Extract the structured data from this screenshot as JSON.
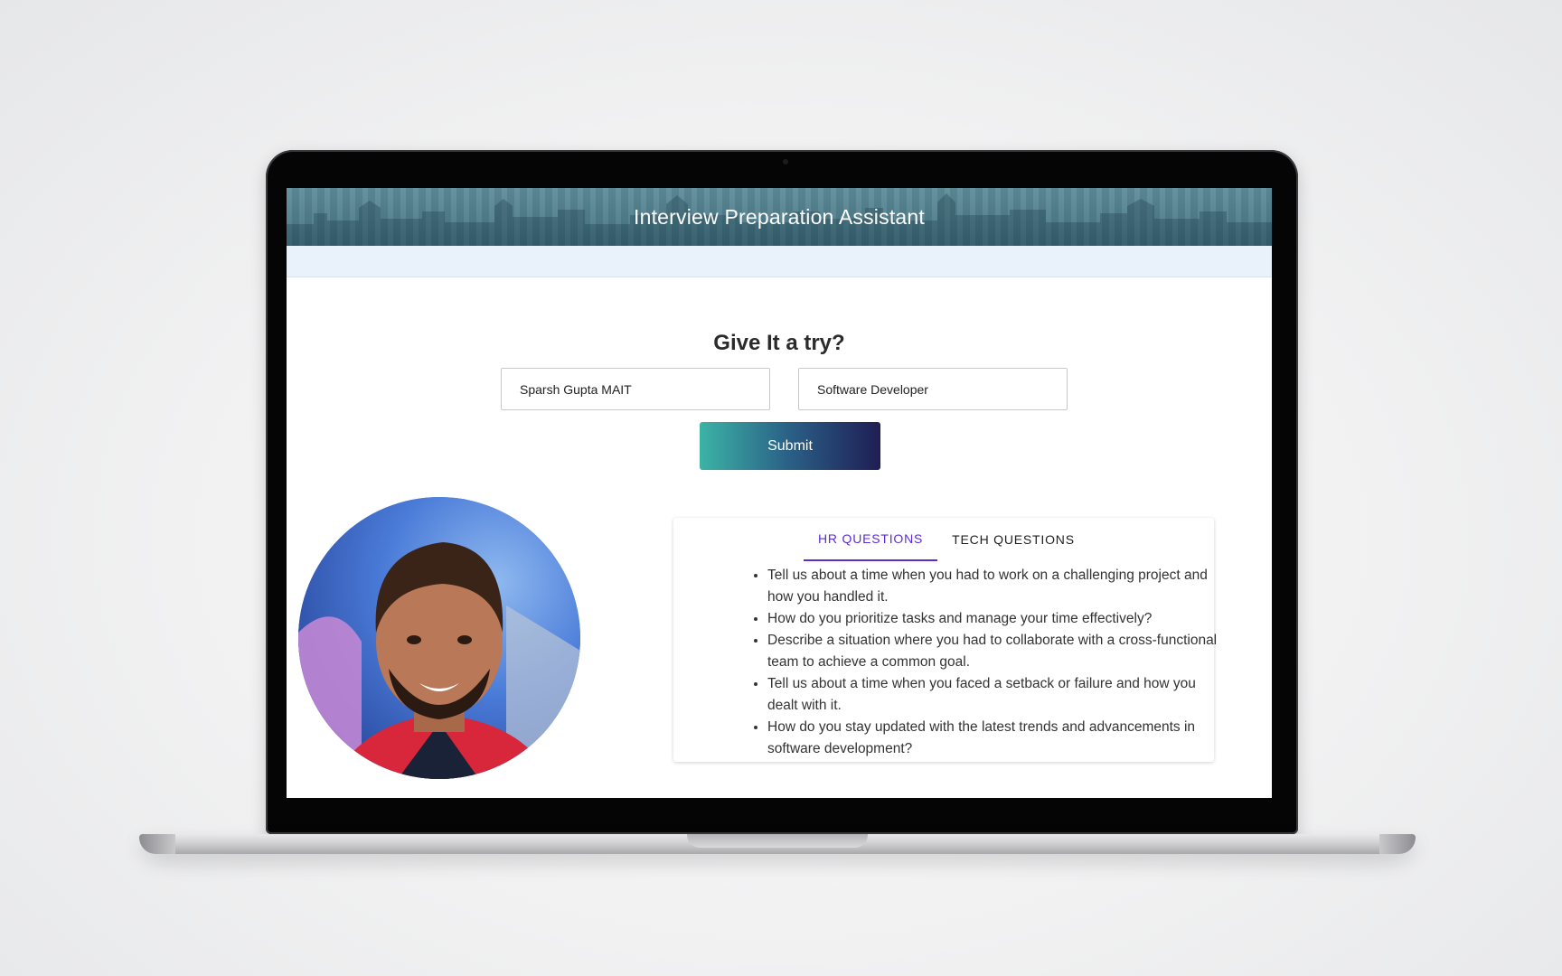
{
  "app": {
    "title": "Interview Preparation Assistant"
  },
  "form": {
    "heading": "Give It a try?",
    "name_value": "Sparsh Gupta MAIT",
    "role_value": "Software Developer",
    "submit_label": "Submit"
  },
  "tabs": [
    {
      "label": "HR QUESTIONS",
      "active": true
    },
    {
      "label": "TECH QUESTIONS",
      "active": false
    }
  ],
  "questions": [
    "Tell us about a time when you had to work on a challenging project and how you handled it.",
    "How do you prioritize tasks and manage your time effectively?",
    "Describe a situation where you had to collaborate with a cross-functional team to achieve a common goal.",
    "Tell us about a time when you faced a setback or failure and how you dealt with it.",
    "How do you stay updated with the latest trends and advancements in software development?"
  ],
  "colors": {
    "accent": "#5b2bd6",
    "header": "#4f7d8c",
    "button_start": "#3cb3a6",
    "button_end": "#1f1e54"
  }
}
